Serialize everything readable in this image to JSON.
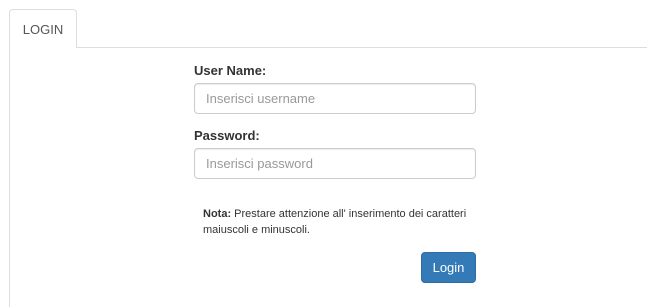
{
  "tabs": {
    "login_label": "LOGIN"
  },
  "form": {
    "username_label": "User Name:",
    "username_placeholder": "Inserisci username",
    "username_value": "",
    "password_label": "Password:",
    "password_placeholder": "Inserisci password",
    "password_value": "",
    "note_prefix": "Nota:",
    "note_text": "Prestare attenzione all' inserimento dei caratteri maiuscoli e minuscoli.",
    "login_button": "Login"
  },
  "colors": {
    "primary_button": "#337ab7",
    "border": "#dddddd"
  }
}
